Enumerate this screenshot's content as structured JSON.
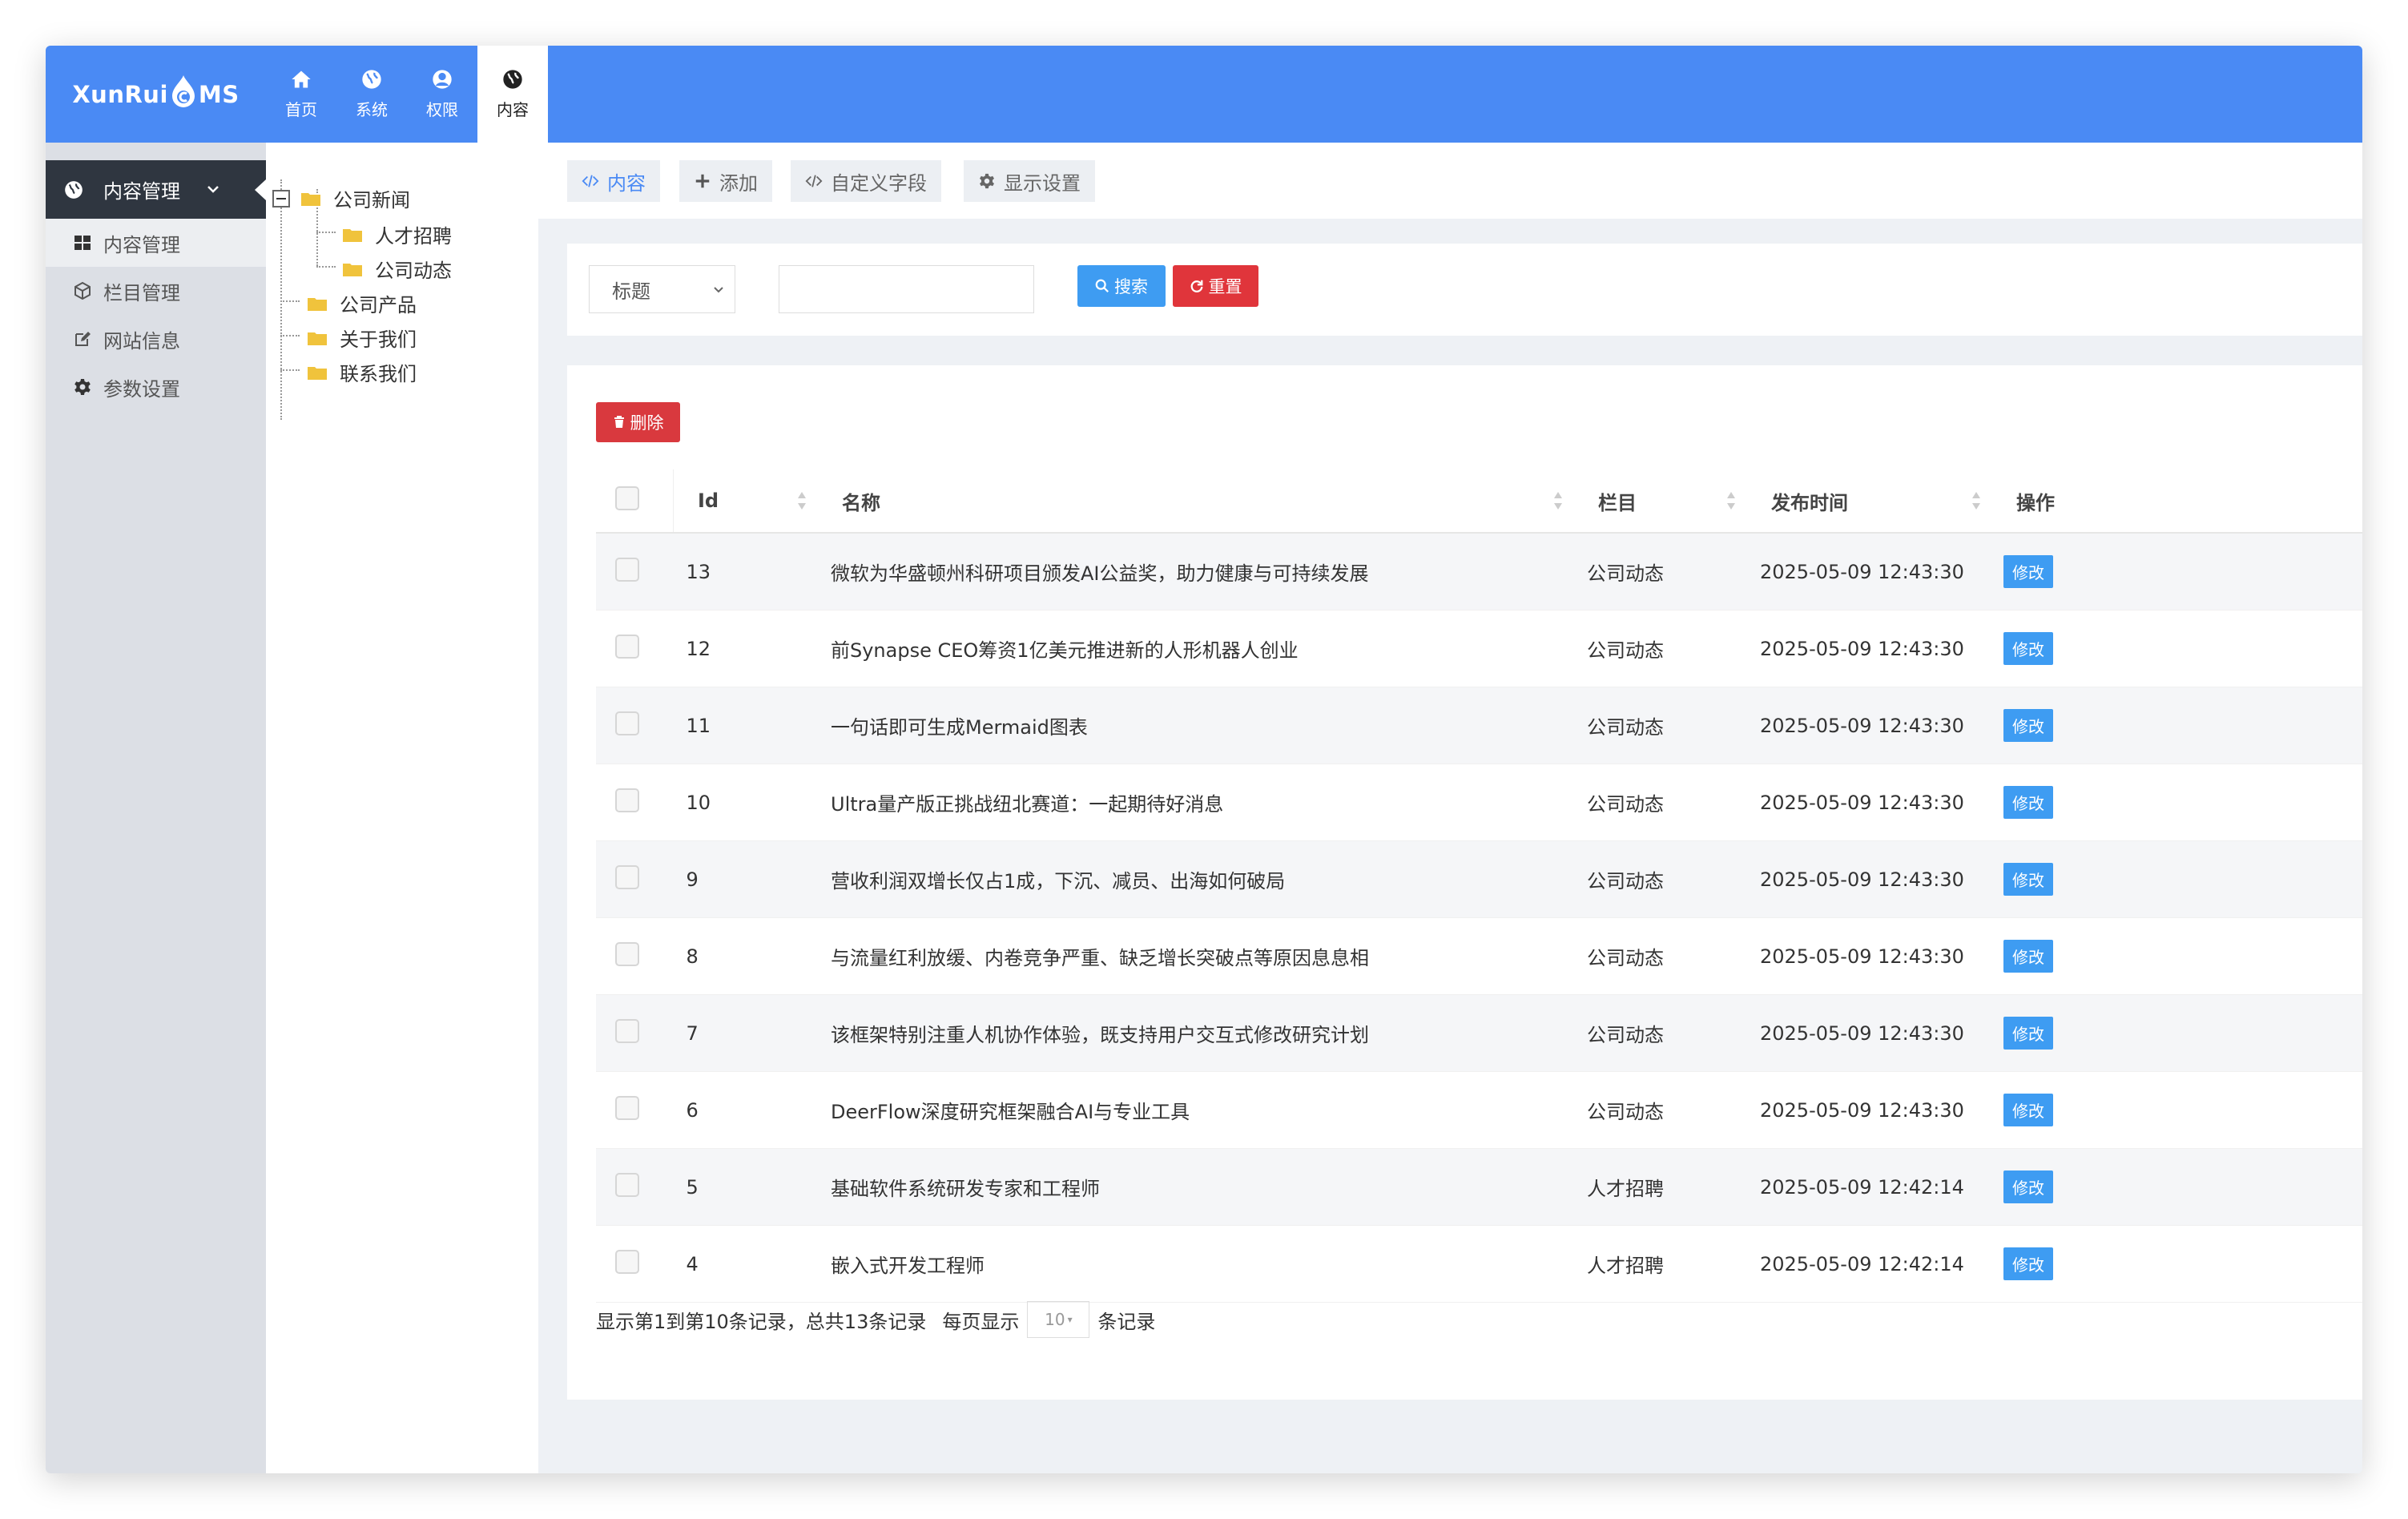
{
  "logo": {
    "text_a": "XunRui",
    "text_b": "MS"
  },
  "topnav": [
    {
      "label": "首页",
      "icon": "home-icon"
    },
    {
      "label": "系统",
      "icon": "globe-icon"
    },
    {
      "label": "权限",
      "icon": "user-icon"
    },
    {
      "label": "内容",
      "icon": "globe-icon",
      "active": true
    }
  ],
  "sidebar": {
    "heading": "内容管理",
    "items": [
      {
        "label": "内容管理",
        "icon": "grid-icon",
        "active": true
      },
      {
        "label": "栏目管理",
        "icon": "cube-icon"
      },
      {
        "label": "网站信息",
        "icon": "edit-icon"
      },
      {
        "label": "参数设置",
        "icon": "gear-icon"
      }
    ]
  },
  "tree": {
    "root": "公司新闻",
    "children": [
      "人才招聘",
      "公司动态"
    ],
    "siblings": [
      "公司产品",
      "关于我们",
      "联系我们"
    ]
  },
  "toolbar": {
    "content": "内容",
    "add": "添加",
    "custom_field": "自定义字段",
    "display": "显示设置"
  },
  "filter": {
    "field": "标题",
    "search": "搜索",
    "reset": "重置",
    "keyword": ""
  },
  "actions": {
    "delete": "删除"
  },
  "table": {
    "headers": {
      "id": "Id",
      "name": "名称",
      "category": "栏目",
      "time": "发布时间",
      "ops": "操作"
    },
    "edit_label": "修改",
    "rows": [
      {
        "id": "13",
        "name": "微软为华盛顿州科研项目颁发AI公益奖，助力健康与可持续发展",
        "category": "公司动态",
        "time": "2025-05-09 12:43:30"
      },
      {
        "id": "12",
        "name": "前Synapse CEO筹资1亿美元推进新的人形机器人创业",
        "category": "公司动态",
        "time": "2025-05-09 12:43:30"
      },
      {
        "id": "11",
        "name": "一句话即可生成Mermaid图表",
        "category": "公司动态",
        "time": "2025-05-09 12:43:30"
      },
      {
        "id": "10",
        "name": "Ultra量产版正挑战纽北赛道：一起期待好消息",
        "category": "公司动态",
        "time": "2025-05-09 12:43:30"
      },
      {
        "id": "9",
        "name": "营收利润双增长仅占1成，下沉、减员、出海如何破局",
        "category": "公司动态",
        "time": "2025-05-09 12:43:30"
      },
      {
        "id": "8",
        "name": "与流量红利放缓、内卷竞争严重、缺乏增长突破点等原因息息相",
        "category": "公司动态",
        "time": "2025-05-09 12:43:30"
      },
      {
        "id": "7",
        "name": "该框架特别注重人机协作体验，既支持用户交互式修改研究计划",
        "category": "公司动态",
        "time": "2025-05-09 12:43:30"
      },
      {
        "id": "6",
        "name": "DeerFlow深度研究框架融合AI与专业工具",
        "category": "公司动态",
        "time": "2025-05-09 12:43:30"
      },
      {
        "id": "5",
        "name": "基础软件系统研发专家和工程师",
        "category": "人才招聘",
        "time": "2025-05-09 12:42:14"
      },
      {
        "id": "4",
        "name": "嵌入式开发工程师",
        "category": "人才招聘",
        "time": "2025-05-09 12:42:14"
      }
    ]
  },
  "pager": {
    "summary": "显示第1到第10条记录，总共13条记录",
    "per_page_prefix": "每页显示",
    "per_page": "10",
    "per_page_suffix": "条记录"
  },
  "colors": {
    "header": "#4a8af4",
    "primary": "#3e9cf2",
    "danger": "#e0353b",
    "sidebar": "#dcdfe5",
    "sidebar_head": "#2f3640"
  }
}
